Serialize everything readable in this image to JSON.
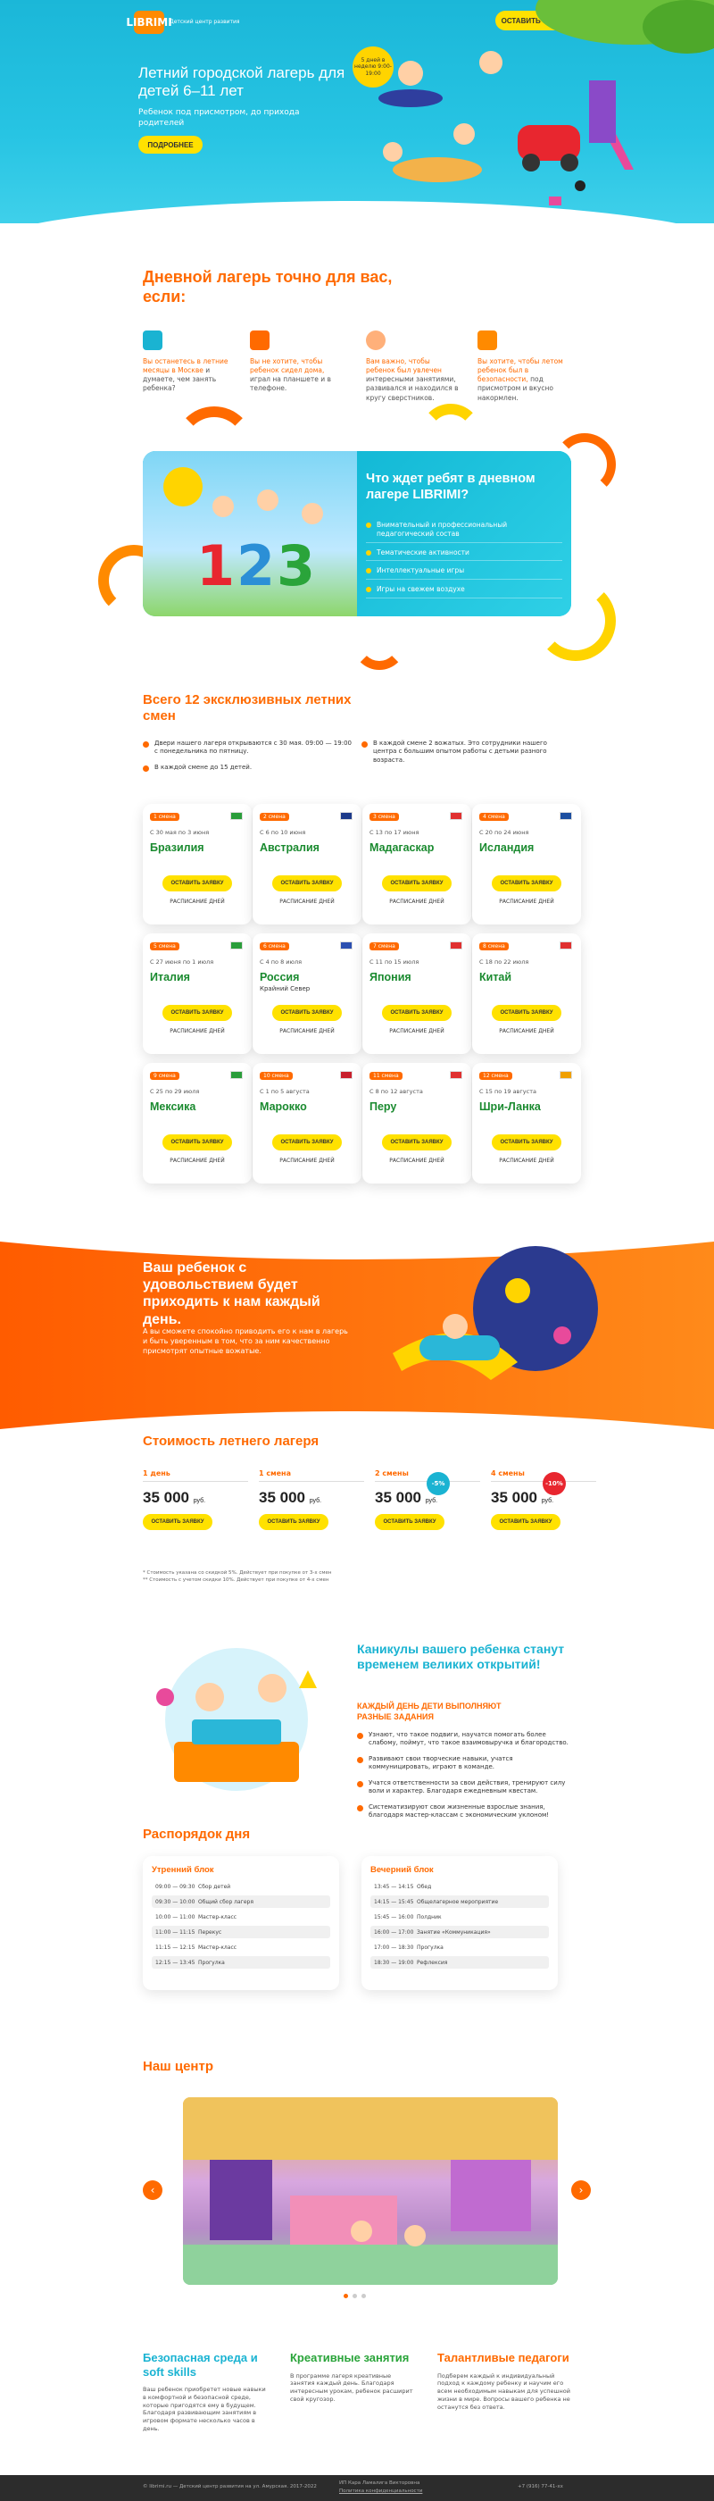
{
  "hero": {
    "logo": "LIBRIMI",
    "logo_sub": "Детский центр развития",
    "cta": "оставить заявку",
    "title": "Летний городской лагерь для детей 6–11 лет",
    "subtitle": "Ребенок под присмотром, до прихода родителей",
    "more": "подробнее",
    "sun_text": "5 дней в неделю 9:00-19:00"
  },
  "for_you": {
    "title": "Дневной лагерь точно для вас, если:",
    "items": [
      {
        "hl": "Вы останетесь в летние месяцы в Москве",
        "rest": " и думаете, чем занять ребенка?"
      },
      {
        "hl": "Вы не хотите, чтобы ребенок сидел дома,",
        "rest": " играл на планшете и в телефоне."
      },
      {
        "hl": "Вам важно, чтобы ребенок был увлечен",
        "rest": " интересными занятиями, развивался и находился в кругу сверстников."
      },
      {
        "hl": "Вы хотите, чтобы летом ребенок был в безопасности,",
        "rest": " под присмотром и вкусно накормлен."
      }
    ]
  },
  "promo": {
    "title": "Что ждет ребят в дневном лагере LIBRIMI?",
    "items": [
      "Внимательный и профессиональный педагогический состав",
      "Тематические активности",
      "Интеллектуальные игры",
      "Игры на свежем воздухе"
    ]
  },
  "shifts": {
    "title": "Всего 12 эксклюзивных летних смен",
    "notes": [
      "Двери нашего лагеря открываются с 30 мая. 09:00 — 19:00 с понедельника по пятницу.",
      "В каждой смене до 15 детей.",
      "В каждой смене 2 вожатых. Это сотрудники нашего центра с большим опытом работы с детьми разного возраста."
    ],
    "btn": "оставить заявку",
    "sched": "расписание дней",
    "cards": [
      {
        "badge": "1 смена",
        "date": "С 30 мая по 3 июня",
        "name": "Бразилия",
        "note": "",
        "flag": "#2a9d3a"
      },
      {
        "badge": "2 смена",
        "date": "С 6 по 10 июня",
        "name": "Австралия",
        "note": "",
        "flag": "#1d3a8a"
      },
      {
        "badge": "3 смена",
        "date": "С 13 по 17 июня",
        "name": "Мадагаскар",
        "note": "",
        "flag": "#e03030"
      },
      {
        "badge": "4 смена",
        "date": "С 20 по 24 июня",
        "name": "Исландия",
        "note": "",
        "flag": "#1d4fa0"
      },
      {
        "badge": "5 смена",
        "date": "С 27 июня по 1 июля",
        "name": "Италия",
        "note": "",
        "flag": "#2a9d3a"
      },
      {
        "badge": "6 смена",
        "date": "С 4 по 8 июля",
        "name": "Россия",
        "note": "Крайний Север",
        "flag": "#2b4fb0"
      },
      {
        "badge": "7 смена",
        "date": "С 11 по 15 июля",
        "name": "Япония",
        "note": "",
        "flag": "#e03030"
      },
      {
        "badge": "8 смена",
        "date": "С 18 по 22 июля",
        "name": "Китай",
        "note": "",
        "flag": "#e03030"
      },
      {
        "badge": "9 смена",
        "date": "С 25 по 29 июля",
        "name": "Мексика",
        "note": "",
        "flag": "#2a9d3a"
      },
      {
        "badge": "10 смена",
        "date": "С 1 по 5 августа",
        "name": "Марокко",
        "note": "",
        "flag": "#c81f2c"
      },
      {
        "badge": "11 смена",
        "date": "С 8 по 12 августа",
        "name": "Перу",
        "note": "",
        "flag": "#e03030"
      },
      {
        "badge": "12 смена",
        "date": "С 15 по 19 августа",
        "name": "Шри-Ланка",
        "note": "",
        "flag": "#f0a000"
      }
    ]
  },
  "happy": {
    "title": "Ваш ребенок с удовольствием будет приходить к нам каждый день.",
    "text": "А вы сможете спокойно приводить его к нам в лагерь и быть уверенным в том, что за ним качественно присмотрят опытные вожатые."
  },
  "pricing": {
    "title": "Стоимость летнего лагеря",
    "currency": "руб.",
    "btn": "оставить заявку",
    "items": [
      {
        "label": "1 день",
        "price": "35 000",
        "disc": ""
      },
      {
        "label": "1 смена",
        "price": "35 000",
        "disc": ""
      },
      {
        "label": "2 смены",
        "price": "35 000",
        "disc": "-5%"
      },
      {
        "label": "4 смены",
        "price": "35 000",
        "disc": "-10%"
      }
    ],
    "foot1": "* Стоимость указана со скидкой 5%. Действует при покупке от 3-х смен",
    "foot2": "** Стоимость с учетом скидки 10%. Действует при покупке от 4-х смен"
  },
  "discovery": {
    "title": "Каникулы вашего ребенка станут временем великих открытий!",
    "subtitle": "Каждый день дети выполняют разные задания",
    "items": [
      "Узнают, что такое подвиги, научатся помогать более слабому, поймут, что такое взаимовыручка и благородство.",
      "Развивают свои творческие навыки, учатся коммуницировать, играют в команде.",
      "Учатся ответственности за свои действия, тренируют силу воли и характер. Благодаря ежедневным квестам.",
      "Систематизируют свои жизненные взрослые знания, благодаря мастер-классам с экономическим уклоном!"
    ]
  },
  "routine": {
    "title": "Распорядок дня",
    "morning": {
      "title": "Утренний блок",
      "rows": [
        [
          "09:00 — 09:30",
          "Сбор детей"
        ],
        [
          "09:30 — 10:00",
          "Общий сбор лагеря"
        ],
        [
          "10:00 — 11:00",
          "Мастер-класс"
        ],
        [
          "11:00 — 11:15",
          "Перекус"
        ],
        [
          "11:15 — 12:15",
          "Мастер-класс"
        ],
        [
          "12:15 — 13:45",
          "Прогулка"
        ]
      ]
    },
    "evening": {
      "title": "Вечерний блок",
      "rows": [
        [
          "13:45 — 14:15",
          "Обед"
        ],
        [
          "14:15 — 15:45",
          "Общелагерное мероприятие"
        ],
        [
          "15:45 — 16:00",
          "Полдник"
        ],
        [
          "16:00 — 17:00",
          "Занятие «Коммуникация»"
        ],
        [
          "17:00 — 18:30",
          "Прогулка"
        ],
        [
          "18:30 — 19:00",
          "Рефлексия"
        ]
      ]
    }
  },
  "center": {
    "title": "Наш центр",
    "prev": "‹",
    "next": "›"
  },
  "bottom": [
    {
      "title": "Безопасная среда и soft skills",
      "text": "Ваш ребенок приобретет новые навыки в комфортной и безопасной среде, которые пригодятся ему в будущем. Благодаря развивающим занятиям в игровом формате несколько часов в день.",
      "color": "#1ab3d2"
    },
    {
      "title": "Креативные занятия",
      "text": "В программе лагеря креативные занятия каждый день. Благодаря интересным урокам, ребенок расширит свой кругозор.",
      "color": "#2aa43a"
    },
    {
      "title": "Талантливые педагоги",
      "text": "Подберем каждый к индивидуальный подход к каждому ребенку и научим его всем необходимым навыкам для успешной жизни в мире. Вопросы вашего ребенка не останутся без ответа.",
      "color": "#ff6a00"
    }
  ],
  "footer": {
    "left": "© librimi.ru — Детский центр развития на ул. Амурская. 2017-2022",
    "mid": "ИП Кара Ламалига Викторовна",
    "mid2": "Политика конфиденциальности",
    "phone": "+7 (916) 77-41-xx"
  }
}
